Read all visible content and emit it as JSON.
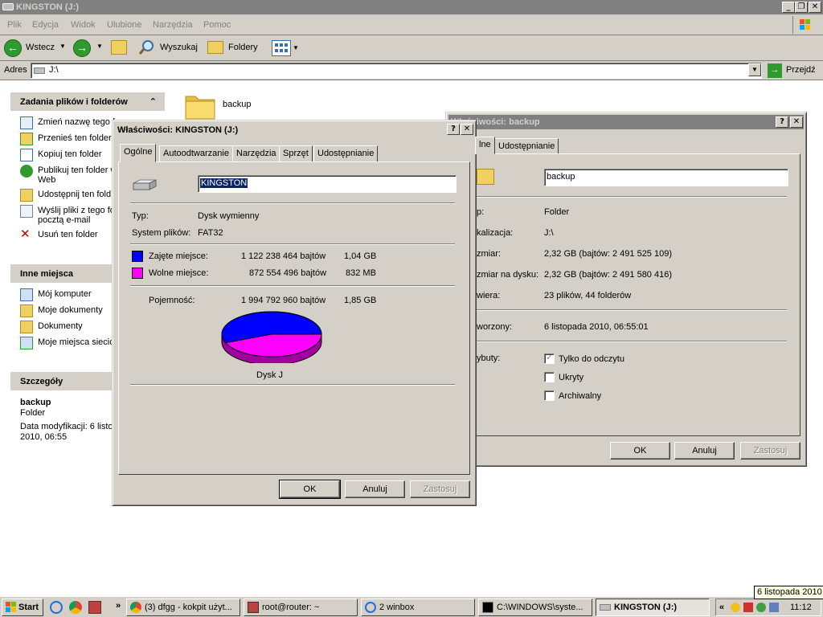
{
  "window": {
    "title": "KINGSTON (J:)"
  },
  "menu": [
    "Plik",
    "Edycja",
    "Widok",
    "Ulubione",
    "Narzędzia",
    "Pomoc"
  ],
  "toolbar": {
    "back": "Wstecz",
    "search": "Wyszukaj",
    "folders": "Foldery"
  },
  "address": {
    "label": "Adres",
    "value": "J:\\",
    "go": "Przejdź"
  },
  "tasks": {
    "header": "Zadania plików i folderów",
    "items": [
      "Zmień nazwę tego f",
      "Przenieś ten folder",
      "Kopiuj ten folder",
      "Publikuj ten folder w",
      "Web",
      "Udostępnij ten fold",
      "Wyślij pliki z tego fo",
      "pocztą e-mail",
      "Usuń ten folder"
    ]
  },
  "other_places": {
    "header": "Inne miejsca",
    "items": [
      "Mój komputer",
      "Moje dokumenty",
      "Dokumenty",
      "Moje miejsca siecio"
    ]
  },
  "details": {
    "header": "Szczegóły",
    "name": "backup",
    "type": "Folder",
    "modified_line1": "Data modyfikacji: 6 listo",
    "modified_line2": "2010, 06:55"
  },
  "content": {
    "folder_name": "backup"
  },
  "drive_dialog": {
    "title": "Właściwości: KINGSTON (J:)",
    "tabs": [
      "Ogólne",
      "Autoodtwarzanie",
      "Narzędzia",
      "Sprzęt",
      "Udostępnianie"
    ],
    "name_value": "KINGSTON",
    "type_label": "Typ:",
    "type_value": "Dysk wymienny",
    "fs_label": "System plików:",
    "fs_value": "FAT32",
    "used_label": "Zajęte miejsce:",
    "used_bytes": "1 122 238 464 bajtów",
    "used_size": "1,04 GB",
    "free_label": "Wolne miejsce:",
    "free_bytes": "872 554 496 bajtów",
    "free_size": "832 MB",
    "capacity_label": "Pojemność:",
    "capacity_bytes": "1 994 792 960 bajtów",
    "capacity_size": "1,85 GB",
    "disk_label": "Dysk J",
    "used_fraction": 0.5626,
    "used_color": "#0000ff",
    "free_color": "#ff00ff",
    "ok": "OK",
    "cancel": "Anuluj",
    "apply": "Zastosuj"
  },
  "folder_dialog": {
    "title": "Właściwości: backup",
    "tab_partial": "lne",
    "tab_share": "Udostępnianie",
    "name_value": "backup",
    "rows": [
      {
        "label": "p:",
        "value": "Folder"
      },
      {
        "label": "kalizacja:",
        "value": "J:\\"
      },
      {
        "label": "zmiar:",
        "value": "2,32 GB (bajtów: 2 491 525 109)"
      },
      {
        "label": "zmiar na dysku:",
        "value": "2,32 GB (bajtów: 2 491 580 416)"
      },
      {
        "label": "wiera:",
        "value": "23 plików, 44 folderów"
      }
    ],
    "created_label": "worzony:",
    "created_value": "6 listopada 2010, 06:55:01",
    "attr_label": "ybuty:",
    "attr_readonly": "Tylko do odczytu",
    "attr_hidden": "Ukryty",
    "attr_archive": "Archiwalny",
    "ok": "OK",
    "cancel": "Anuluj",
    "apply": "Zastosuj"
  },
  "taskbar": {
    "start": "Start",
    "buttons": [
      "(3) dfgg - kokpit użyt...",
      "root@router: ~",
      "2 winbox",
      "C:\\WINDOWS\\syste...",
      "KINGSTON (J:)"
    ],
    "clock": "11:12",
    "tooltip": "6 listopada 2010"
  }
}
